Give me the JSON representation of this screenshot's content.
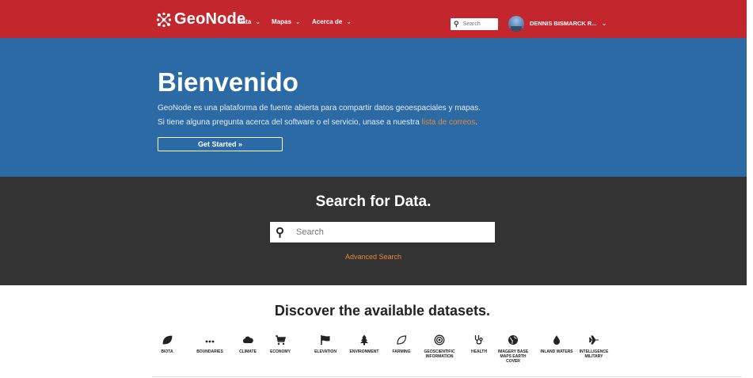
{
  "navbar": {
    "brand": "GeoNode",
    "menu": [
      {
        "label": "Data"
      },
      {
        "label": "Mapas"
      },
      {
        "label": "Acerca de"
      }
    ],
    "search_placeholder": "Search",
    "user": "DENNIS BISMARCK R..."
  },
  "hero": {
    "title": "Bienvenido",
    "line1": "GeoNode es una plataforma de fuente abierta para compartir datos geoespaciales y mapas.",
    "line2_prefix": "Si tiene alguna pregunta acerca del software o el servicio, unase a nuestra ",
    "line2_link": "lista de correos",
    "line2_suffix": ".",
    "button": "Get Started »"
  },
  "search": {
    "title": "Search for Data.",
    "placeholder": "Search",
    "advanced": "Advanced Search"
  },
  "discover": {
    "title": "Discover the available datasets.",
    "categories": [
      {
        "label": "BIOTA",
        "icon": "leaf-icon"
      },
      {
        "label": "BOUNDARIES",
        "icon": "ellipsis-icon"
      },
      {
        "label": "CLIMATE",
        "icon": "cloud-icon"
      },
      {
        "label": "ECONOMY",
        "icon": "cart-icon"
      },
      {
        "label": "ELEVATION",
        "icon": "flag-icon"
      },
      {
        "label": "ENVIRONMENT",
        "icon": "tree-icon"
      },
      {
        "label": "FARMING",
        "icon": "leaf-outline-icon"
      },
      {
        "label": "GEOSCIENTIFIC INFORMATION",
        "icon": "bullseye-icon"
      },
      {
        "label": "HEALTH",
        "icon": "stethoscope-icon"
      },
      {
        "label": "IMAGERY BASE MAPS EARTH COVER",
        "icon": "globe-icon"
      },
      {
        "label": "INLAND WATERS",
        "icon": "tint-icon"
      },
      {
        "label": "INTELLIGENCE MILITARY",
        "icon": "plane-icon"
      }
    ]
  },
  "colors": {
    "navbar": "#c4262e",
    "hero": "#2b6aa5",
    "search_band": "#333333",
    "accent": "#e8883a"
  }
}
